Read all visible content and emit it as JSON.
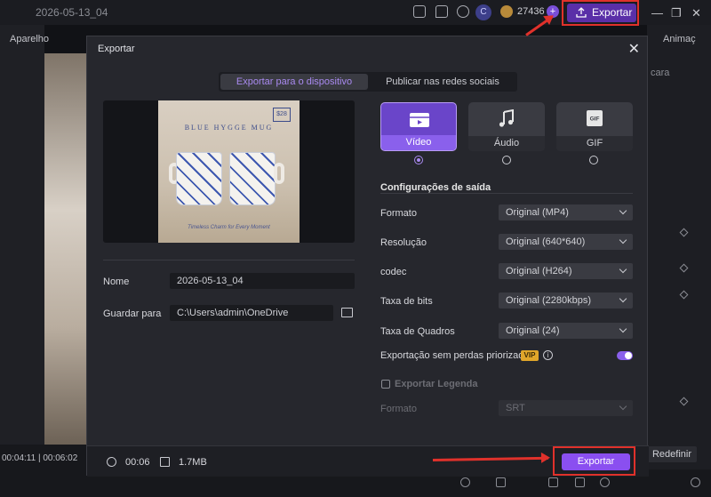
{
  "app": {
    "project_name": "2026-05-13_04",
    "avatar_letter": "C",
    "credits": "27436",
    "top_export_label": "Exportar",
    "left_panel_label": "Aparelho",
    "right_panel_label": "Animaç",
    "right_panel_sub": "cara",
    "reset_label": "Redefinir",
    "time_current": "00:04:11",
    "time_total": "00:06:02"
  },
  "dialog": {
    "title": "Exportar",
    "tabs": [
      {
        "label": "Exportar para o dispositivo",
        "active": true
      },
      {
        "label": "Publicar nas redes sociais",
        "active": false
      }
    ],
    "thumbnail": {
      "brand": "BLUE HYGGE MUG",
      "price": "$28",
      "caption": "Timeless Charm for Every Moment"
    },
    "name_label": "Nome",
    "name_value": "2026-05-13_04",
    "save_label": "Guardar para",
    "save_path": "C:\\Users\\admin\\OneDrive",
    "formats": [
      {
        "label": "Vídeo",
        "icon": "video-icon",
        "selected": true
      },
      {
        "label": "Áudio",
        "icon": "music-note-icon",
        "selected": false
      },
      {
        "label": "GIF",
        "icon": "gif-icon",
        "selected": false
      }
    ],
    "settings_title": "Configurações de saída",
    "settings": [
      {
        "label": "Formato",
        "value": "Original (MP4)"
      },
      {
        "label": "Resolução",
        "value": "Original (640*640)"
      },
      {
        "label": "codec",
        "value": "Original (H264)"
      },
      {
        "label": "Taxa de bits",
        "value": "Original (2280kbps)"
      },
      {
        "label": "Taxa de Quadros",
        "value": "Original (24)"
      }
    ],
    "lossless_label": "Exportação sem perdas priorizada",
    "vip_badge": "VIP",
    "lossless_on": true,
    "subtitle_label": "Exportar Legenda",
    "subtitle_format_label": "Formato",
    "subtitle_format_value": "SRT",
    "duration": "00:06",
    "size": "1.7MB",
    "export_label": "Exportar"
  },
  "colors": {
    "accent": "#8a4ff0",
    "highlight": "#e0312b",
    "dialog_bg": "#26272d"
  }
}
